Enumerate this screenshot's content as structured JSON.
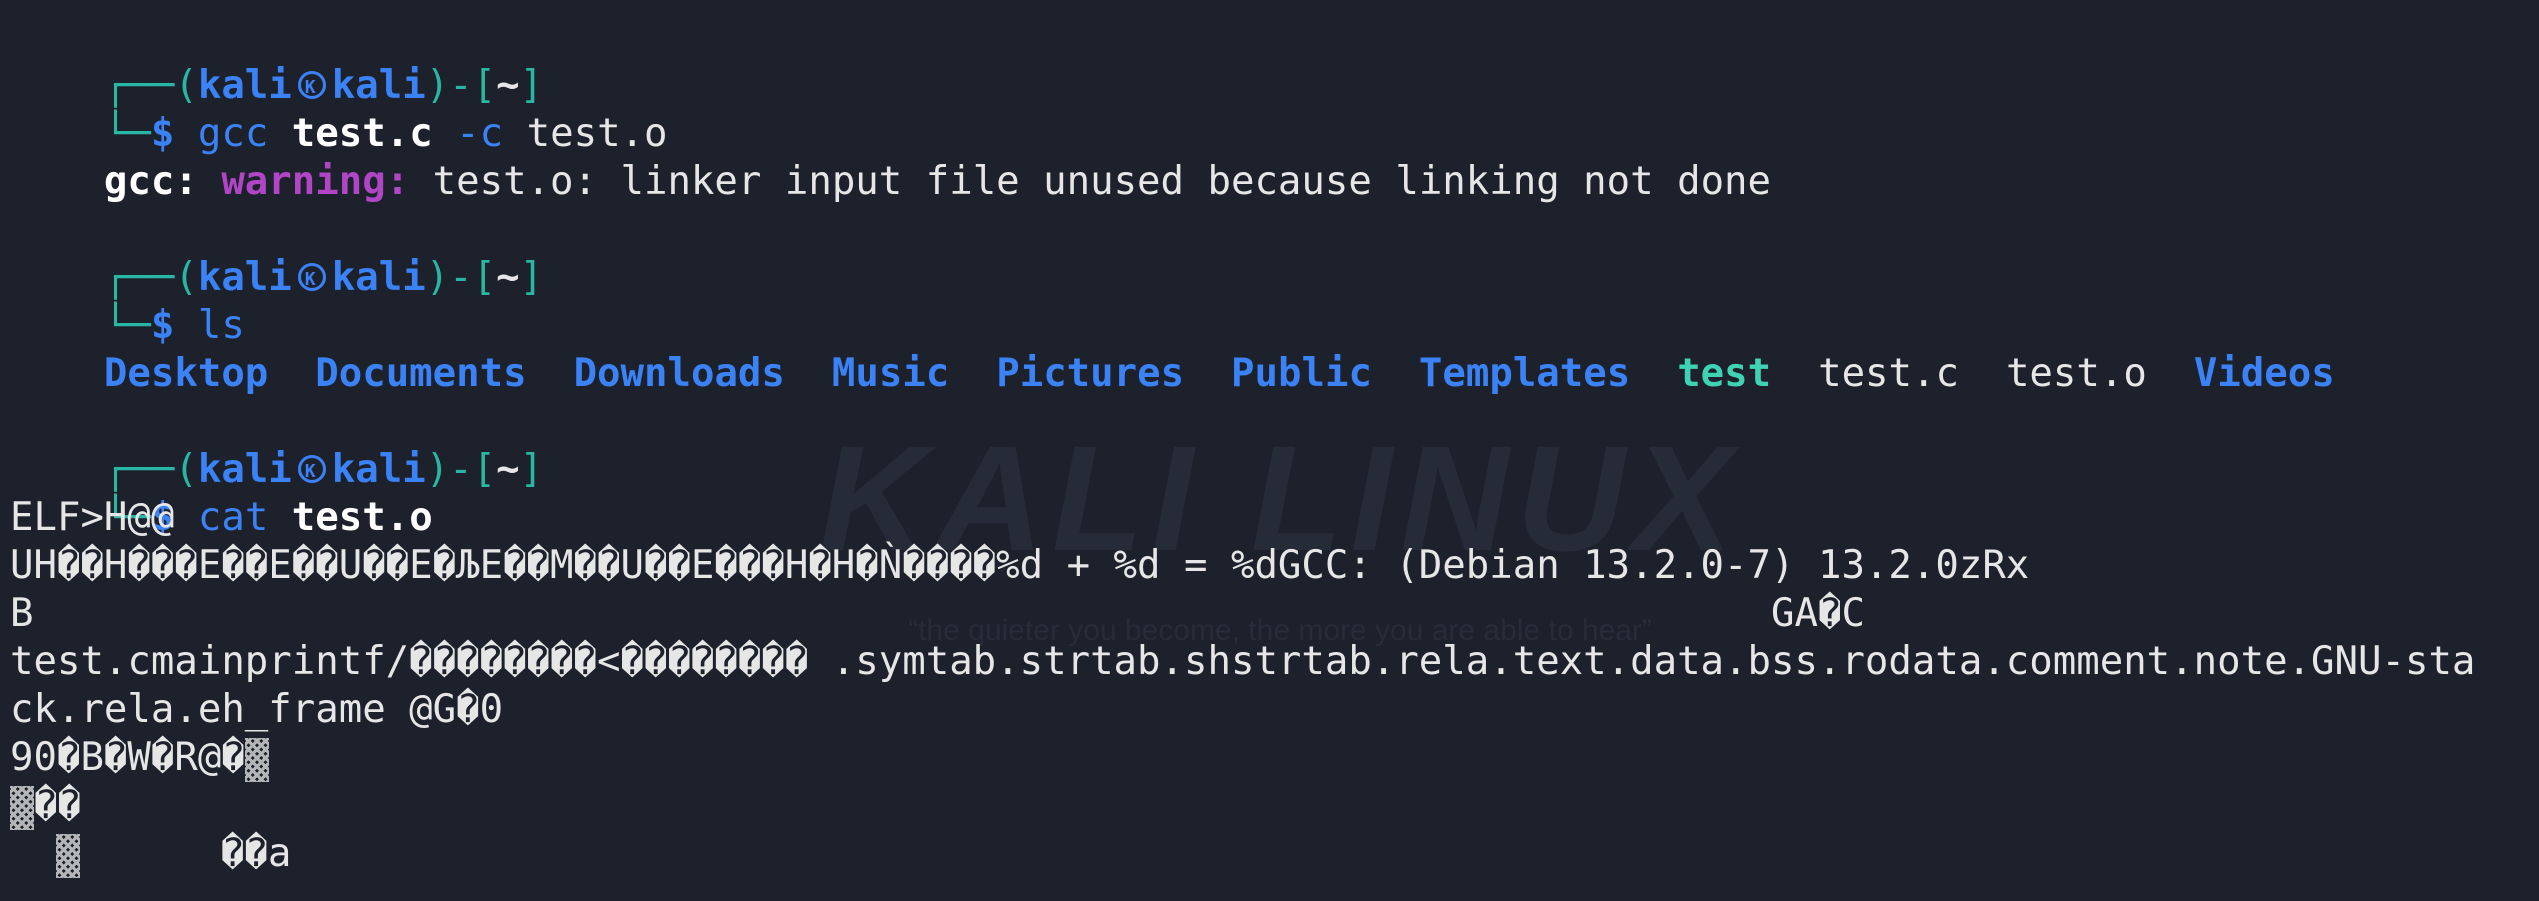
{
  "prompt": {
    "user": "kali",
    "host": "kali",
    "cwd": "~"
  },
  "blocks": [
    {
      "command": "gcc",
      "args": [
        {
          "text": "test.c",
          "style": "bold"
        },
        {
          "text": "-c",
          "style": "opt"
        },
        {
          "text": "test.o",
          "style": "plain"
        }
      ],
      "output": {
        "program": "gcc:",
        "level": "warning:",
        "message": "test.o: linker input file unused because linking not done"
      }
    },
    {
      "command": "ls",
      "entries": [
        {
          "name": "Desktop",
          "type": "dir"
        },
        {
          "name": "Documents",
          "type": "dir"
        },
        {
          "name": "Downloads",
          "type": "dir"
        },
        {
          "name": "Music",
          "type": "dir"
        },
        {
          "name": "Pictures",
          "type": "dir"
        },
        {
          "name": "Public",
          "type": "dir"
        },
        {
          "name": "Templates",
          "type": "dir"
        },
        {
          "name": "test",
          "type": "exec"
        },
        {
          "name": "test.c",
          "type": "file"
        },
        {
          "name": "test.o",
          "type": "file"
        },
        {
          "name": "Videos",
          "type": "dir"
        }
      ]
    },
    {
      "command": "cat",
      "arg": "test.o",
      "output_lines": [
        "ELF>H@@",
        "UH��H���E��E��U��E�ЉE��M��U��E���H�H�Ǹ����%d + %d = %dGCC: (Debian 13.2.0-7) 13.2.0zRx",
        "B                                                                          GA�C",
        "test.cmainprintf/��������<�������� .symtab.strtab.shstrtab.rela.text.data.bss.rodata.comment.note.GNU-sta",
        "ck.rela.eh_frame @G�0",
        "90�B�W�R@�",
        "��",
        "      ��a"
      ]
    }
  ],
  "watermark": {
    "title": "KALI LINUX",
    "tagline": "“the quieter you become, the more you are able to hear”"
  },
  "colors": {
    "background": "#1d212c",
    "prompt_box": "#29b6a4",
    "kali_blue": "#3b82f6",
    "warning_purple": "#b046c6",
    "exec_teal": "#3fd3b4",
    "text": "#e6e6e6"
  }
}
